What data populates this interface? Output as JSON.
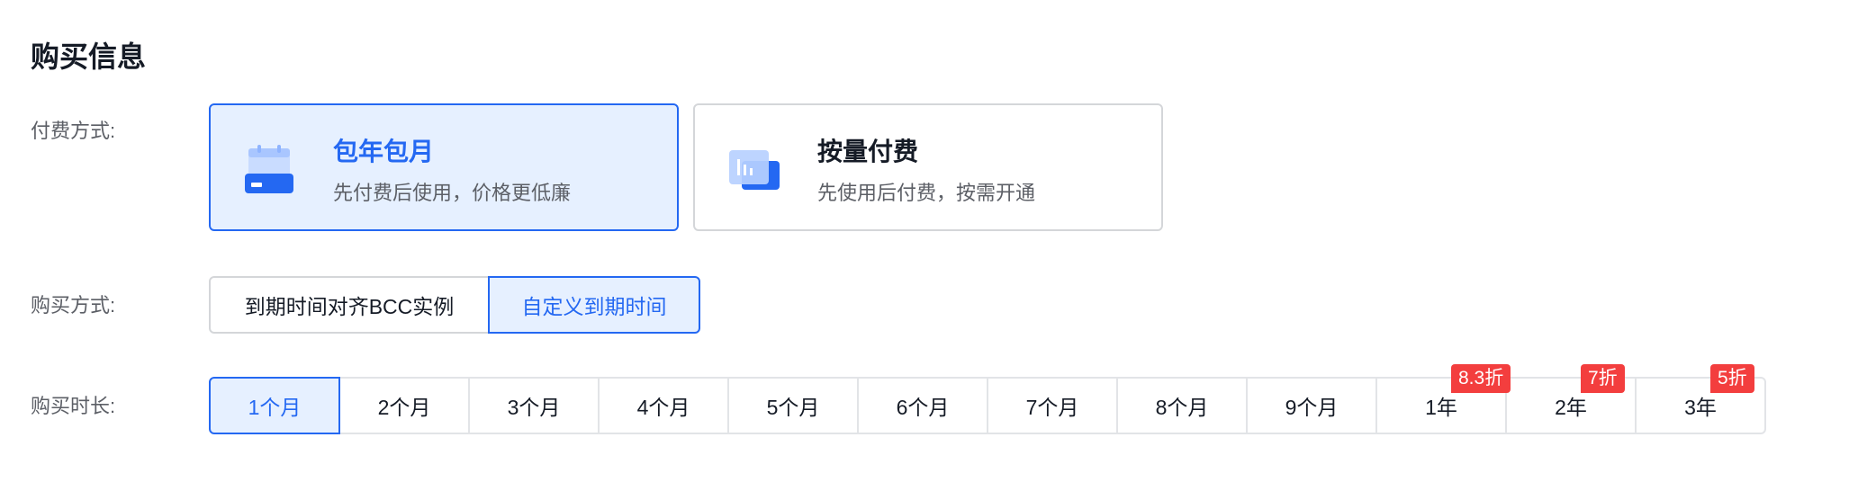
{
  "section": {
    "title": "购买信息"
  },
  "billing": {
    "label": "付费方式:",
    "options": [
      {
        "title": "包年包月",
        "desc": "先付费后使用，价格更低廉",
        "selected": true,
        "icon": "calendar-icon"
      },
      {
        "title": "按量付费",
        "desc": "先使用后付费，按需开通",
        "selected": false,
        "icon": "chart-card-icon"
      }
    ]
  },
  "purchase_mode": {
    "label": "购买方式:",
    "options": [
      {
        "label": "到期时间对齐BCC实例",
        "selected": false
      },
      {
        "label": "自定义到期时间",
        "selected": true
      }
    ]
  },
  "duration": {
    "label": "购买时长:",
    "options": [
      {
        "label": "1个月",
        "selected": true
      },
      {
        "label": "2个月"
      },
      {
        "label": "3个月"
      },
      {
        "label": "4个月"
      },
      {
        "label": "5个月"
      },
      {
        "label": "6个月"
      },
      {
        "label": "7个月"
      },
      {
        "label": "8个月"
      },
      {
        "label": "9个月"
      },
      {
        "label": "1年",
        "badge": "8.3折"
      },
      {
        "label": "2年",
        "badge": "7折"
      },
      {
        "label": "3年",
        "badge": "5折"
      }
    ]
  },
  "colors": {
    "primary": "#2468f2",
    "selected_bg": "#e6f0ff",
    "badge": "#f33e3e"
  }
}
